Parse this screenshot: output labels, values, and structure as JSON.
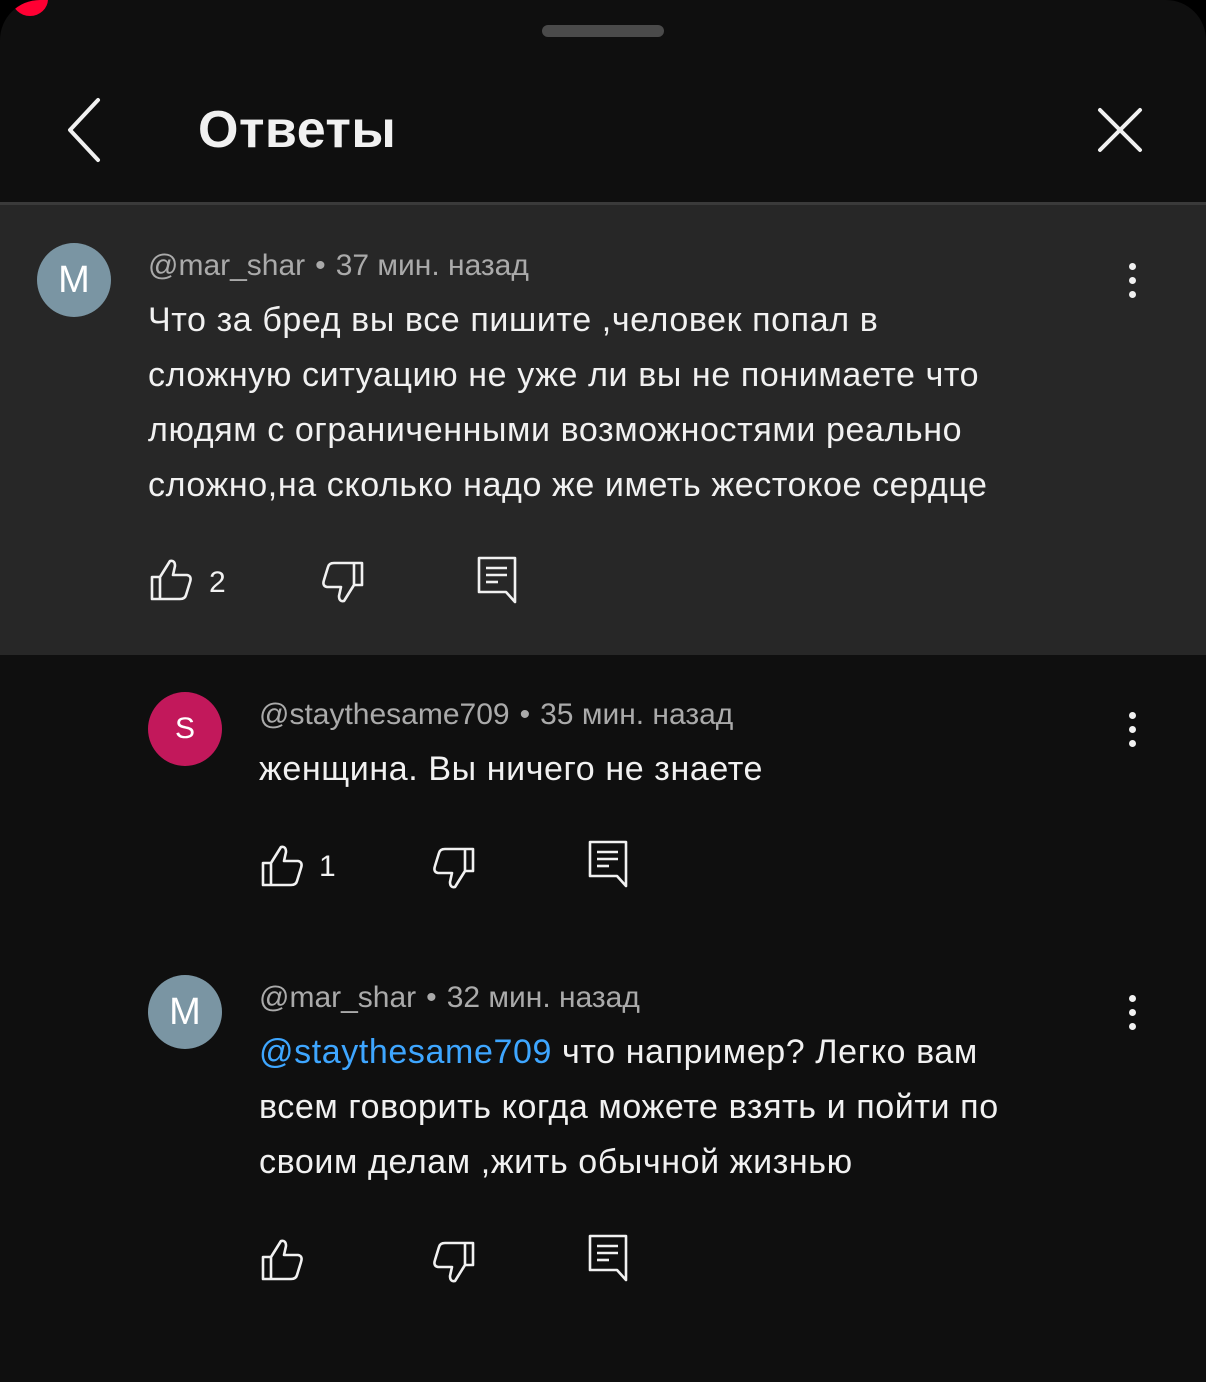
{
  "header": {
    "title": "Ответы"
  },
  "icons": {
    "back": "chevron-left-icon",
    "close": "close-icon",
    "more": "more-vert-icon",
    "like": "thumb-up-icon",
    "dislike": "thumb-down-icon",
    "reply": "reply-comment-icon"
  },
  "colors": {
    "background": "#0f0f0f",
    "parent_background": "#272727",
    "mention": "#3ea6ff",
    "avatar_m": "#7a95a3",
    "avatar_s": "#c2185b",
    "recording_dot": "#ff0033"
  },
  "comments": [
    {
      "avatar_letter": "M",
      "author": "@mar_shar",
      "separator": "•",
      "time": "37 мин. назад",
      "lines": [
        "Что за бред вы все пишите ,человек попал в",
        "сложную ситуацию не уже ли вы не понимаете что",
        "людям с ограниченными возможностями реально",
        "сложно,на сколько надо же иметь жестокое сердце"
      ],
      "likes": "2"
    },
    {
      "avatar_letter": "S",
      "author": "@staythesame709",
      "separator": "•",
      "time": "35 мин. назад",
      "lines": [
        "женщина. Вы ничего не знаете"
      ],
      "likes": "1"
    },
    {
      "avatar_letter": "M",
      "author": "@mar_shar",
      "separator": "•",
      "time": "32 мин. назад",
      "mention": "@staythesame709",
      "lines": [
        " что например? Легко вам",
        "всем говорить когда можете взять и пойти по",
        "своим делам ,жить обычной жизнью"
      ],
      "likes": ""
    }
  ]
}
